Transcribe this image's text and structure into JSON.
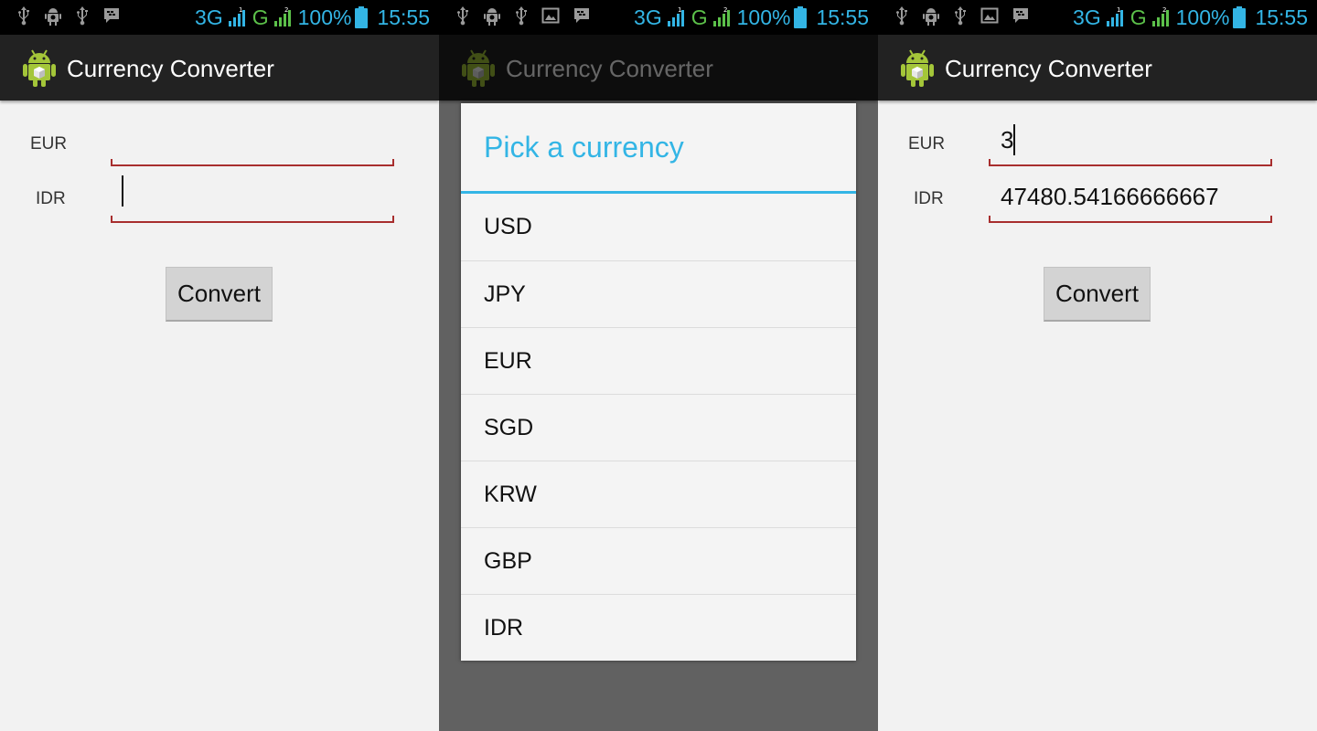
{
  "status_bar": {
    "network_1": "3G",
    "network_2": "G",
    "sim_1": "1",
    "sim_2": "2",
    "battery_percent": "100%",
    "time": "15:55",
    "colors": {
      "accent": "#33b5e5",
      "g_network": "#5cc14a"
    },
    "left_icons_screen_1": [
      "usb-icon",
      "android-debug-icon",
      "usb-icon",
      "bbm-icon"
    ],
    "left_icons_screen_2": [
      "usb-icon",
      "android-debug-icon",
      "usb-icon",
      "image-icon",
      "bbm-icon"
    ],
    "left_icons_screen_3": [
      "usb-icon",
      "android-debug-icon",
      "usb-icon",
      "image-icon",
      "bbm-icon"
    ]
  },
  "app": {
    "title": "Currency Converter",
    "icon": "android-app-icon"
  },
  "screen_1": {
    "eur_label": "EUR",
    "eur_value": "",
    "idr_label": "IDR",
    "idr_value": "",
    "focused_field": "IDR",
    "convert_label": "Convert"
  },
  "screen_2": {
    "dialog_title": "Pick a currency",
    "options": [
      "USD",
      "JPY",
      "EUR",
      "SGD",
      "KRW",
      "GBP",
      "IDR"
    ]
  },
  "screen_3": {
    "eur_label": "EUR",
    "eur_value": "3",
    "idr_label": "IDR",
    "idr_value": "47480.54166666667",
    "focused_field": "EUR",
    "convert_label": "Convert"
  },
  "theme": {
    "action_bar_bg": "#222222",
    "content_bg": "#f2f2f2",
    "field_underline": "#a82e2e",
    "dialog_accent": "#33b5e5",
    "button_bg": "#d3d3d3"
  }
}
